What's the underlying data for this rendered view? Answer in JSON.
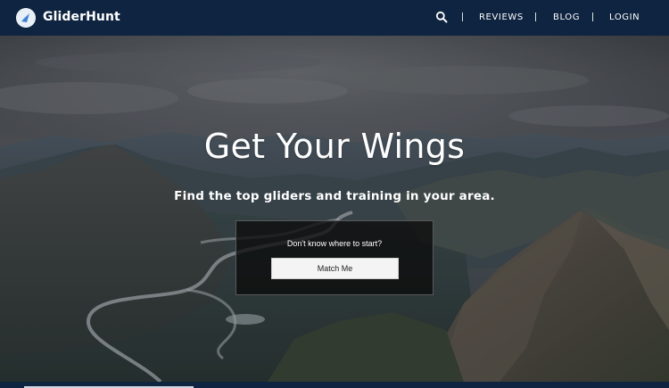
{
  "header": {
    "brand": "GliderHunt",
    "nav": {
      "reviews": "REVIEWS",
      "blog": "BLOG",
      "login": "LOGIN"
    },
    "icons": {
      "logo": "glider-logo-icon",
      "search": "search-icon"
    }
  },
  "hero": {
    "title": "Get Your Wings",
    "subtitle": "Find the top gliders and training in your area.",
    "cta": {
      "prompt": "Don't know where to start?",
      "button_label": "Match Me"
    }
  },
  "colors": {
    "navbar": "#0f2440",
    "cta_overlay": "#0c0c0c",
    "button": "#f4f4f4"
  }
}
